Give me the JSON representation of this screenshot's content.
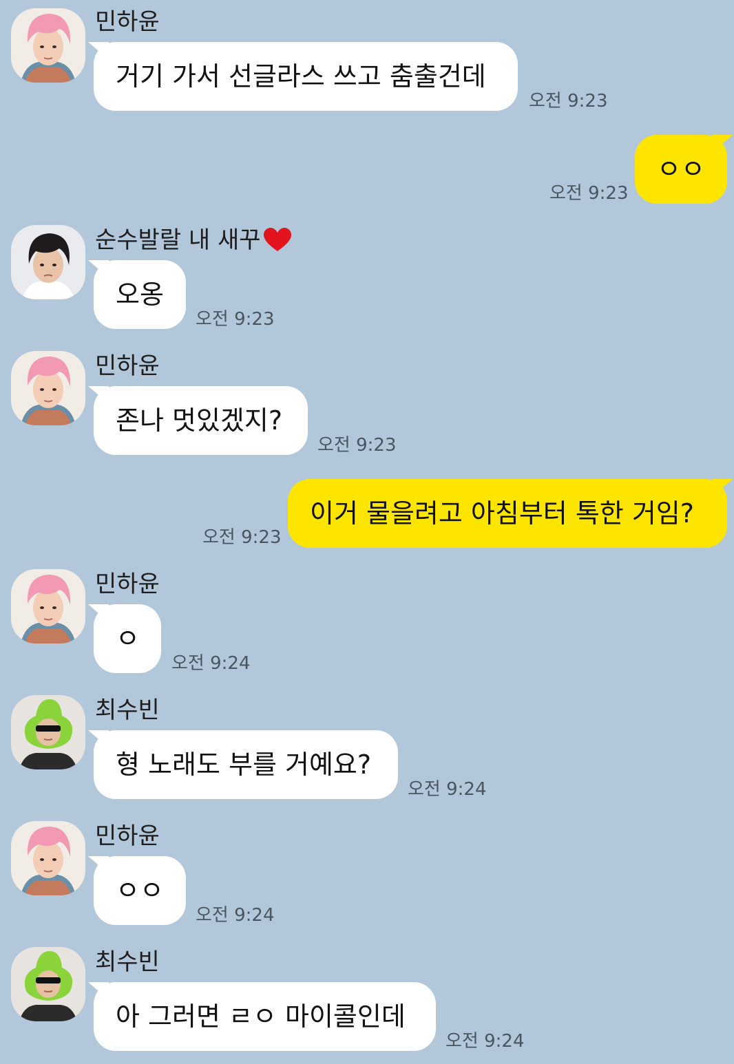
{
  "theme": {
    "background": "#b2c7d9",
    "incoming_bubble": "#ffffff",
    "outgoing_bubble": "#fee500"
  },
  "messages": [
    {
      "type": "in",
      "sender": "민하윤",
      "avatar": "pink-hair-avatar",
      "text": "거기 가서 선글라스 쓰고 춤출건데",
      "time": "오전 9:23"
    },
    {
      "type": "out",
      "text": "ㅇㅇ",
      "time": "오전 9:23"
    },
    {
      "type": "in",
      "sender": "순수발랄 내 새꾸",
      "sender_emoji": "heart-icon",
      "avatar": "dark-hair-avatar",
      "text": "오옹",
      "time": "오전 9:23"
    },
    {
      "type": "in",
      "sender": "민하윤",
      "avatar": "pink-hair-avatar",
      "text": "존나 멋있겠지?",
      "time": "오전 9:23"
    },
    {
      "type": "out",
      "text": "이거 물을려고 아침부터 톡한 거임?",
      "time": "오전 9:23"
    },
    {
      "type": "in",
      "sender": "민하윤",
      "avatar": "pink-hair-avatar",
      "text": "ㅇ",
      "time": "오전 9:24"
    },
    {
      "type": "in",
      "sender": "최수빈",
      "avatar": "green-hat-avatar",
      "text": "형 노래도 부를 거예요?",
      "time": "오전 9:24"
    },
    {
      "type": "in",
      "sender": "민하윤",
      "avatar": "pink-hair-avatar",
      "text": "ㅇㅇ",
      "time": "오전 9:24"
    },
    {
      "type": "in",
      "sender": "최수빈",
      "avatar": "green-hat-avatar",
      "text": "아 그러면 ㄹㅇ 마이콜인데",
      "time": "오전 9:24"
    }
  ]
}
